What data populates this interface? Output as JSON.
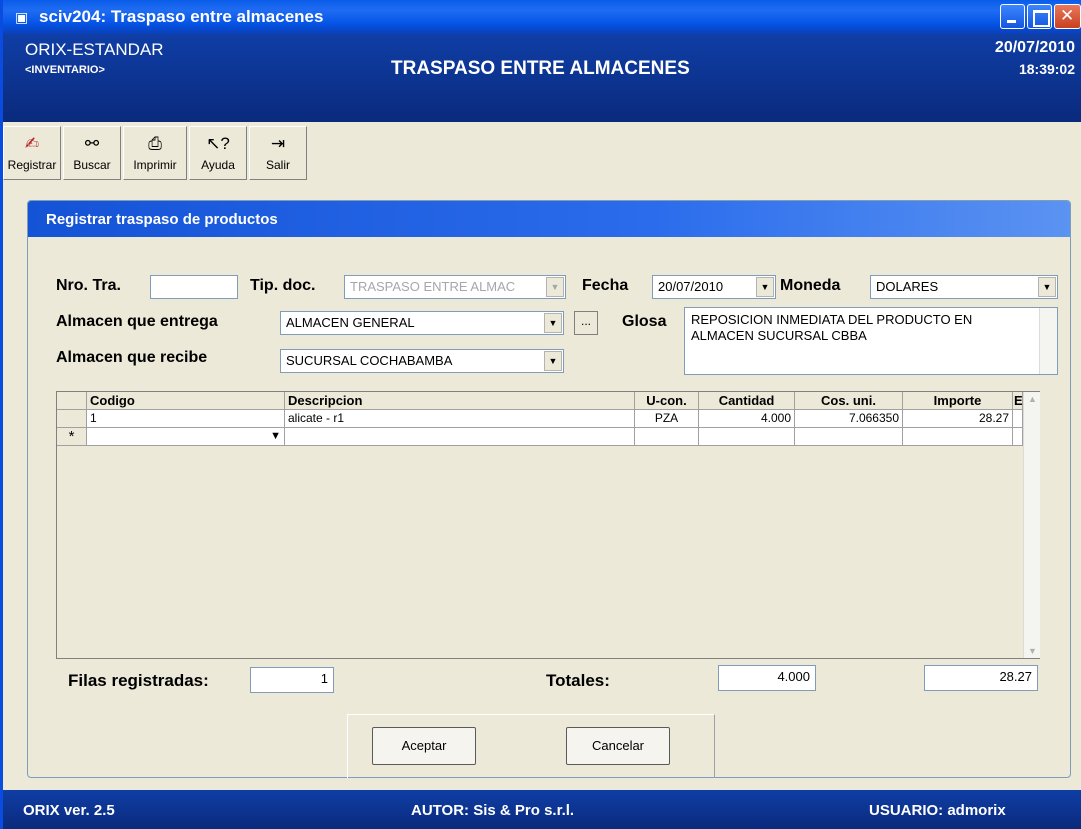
{
  "window": {
    "title": "sciv204: Traspaso entre almacenes"
  },
  "header": {
    "company": "ORIX-ESTANDAR",
    "module": "<INVENTARIO>",
    "form_title": "TRASPASO ENTRE ALMACENES",
    "date": "20/07/2010",
    "time": "18:39:02"
  },
  "toolbar": {
    "registrar": "Registrar",
    "buscar": "Buscar",
    "imprimir": "Imprimir",
    "ayuda": "Ayuda",
    "salir": "Salir"
  },
  "panel": {
    "title": "Registrar traspaso de productos"
  },
  "form": {
    "nro_tra_label": "Nro. Tra.",
    "nro_tra_value": "",
    "tip_doc_label": "Tip. doc.",
    "tip_doc_value": "TRASPASO ENTRE ALMAC",
    "fecha_label": "Fecha",
    "fecha_value": "20/07/2010",
    "moneda_label": "Moneda",
    "moneda_value": "DOLARES",
    "almacen_entrega_label": "Almacen que entrega",
    "almacen_entrega_value": "ALMACEN GENERAL",
    "almacen_recibe_label": "Almacen que recibe",
    "almacen_recibe_value": "SUCURSAL COCHABAMBA",
    "glosa_label": "Glosa",
    "glosa_value": "REPOSICION INMEDIATA DEL PRODUCTO EN ALMACEN SUCURSAL CBBA",
    "ellipsis": "..."
  },
  "grid": {
    "columns": [
      "Codigo",
      "Descripcion",
      "U-con.",
      "Cantidad",
      "Cos. uni.",
      "Importe",
      "E"
    ],
    "rows": [
      {
        "codigo": "1",
        "descripcion": "alicate - r1",
        "ucon": "PZA",
        "cantidad": "4.000",
        "cos_uni": "7.066350",
        "importe": "28.27",
        "e": ""
      }
    ],
    "new_row_marker": "*"
  },
  "totals": {
    "filas_label": "Filas registradas:",
    "filas_value": "1",
    "totales_label": "Totales:",
    "cantidad_total": "4.000",
    "importe_total": "28.27"
  },
  "buttons": {
    "aceptar": "Aceptar",
    "cancelar": "Cancelar"
  },
  "status": {
    "version": "ORIX ver. 2.5",
    "autor": "AUTOR: Sis & Pro s.r.l.",
    "usuario": "USUARIO: admorix"
  },
  "colors": {
    "title_bar": "#0a5ce8",
    "header_bg": "#0f3ea6",
    "panel_head": "#1553d6",
    "window_bg": "#ece9d8"
  }
}
